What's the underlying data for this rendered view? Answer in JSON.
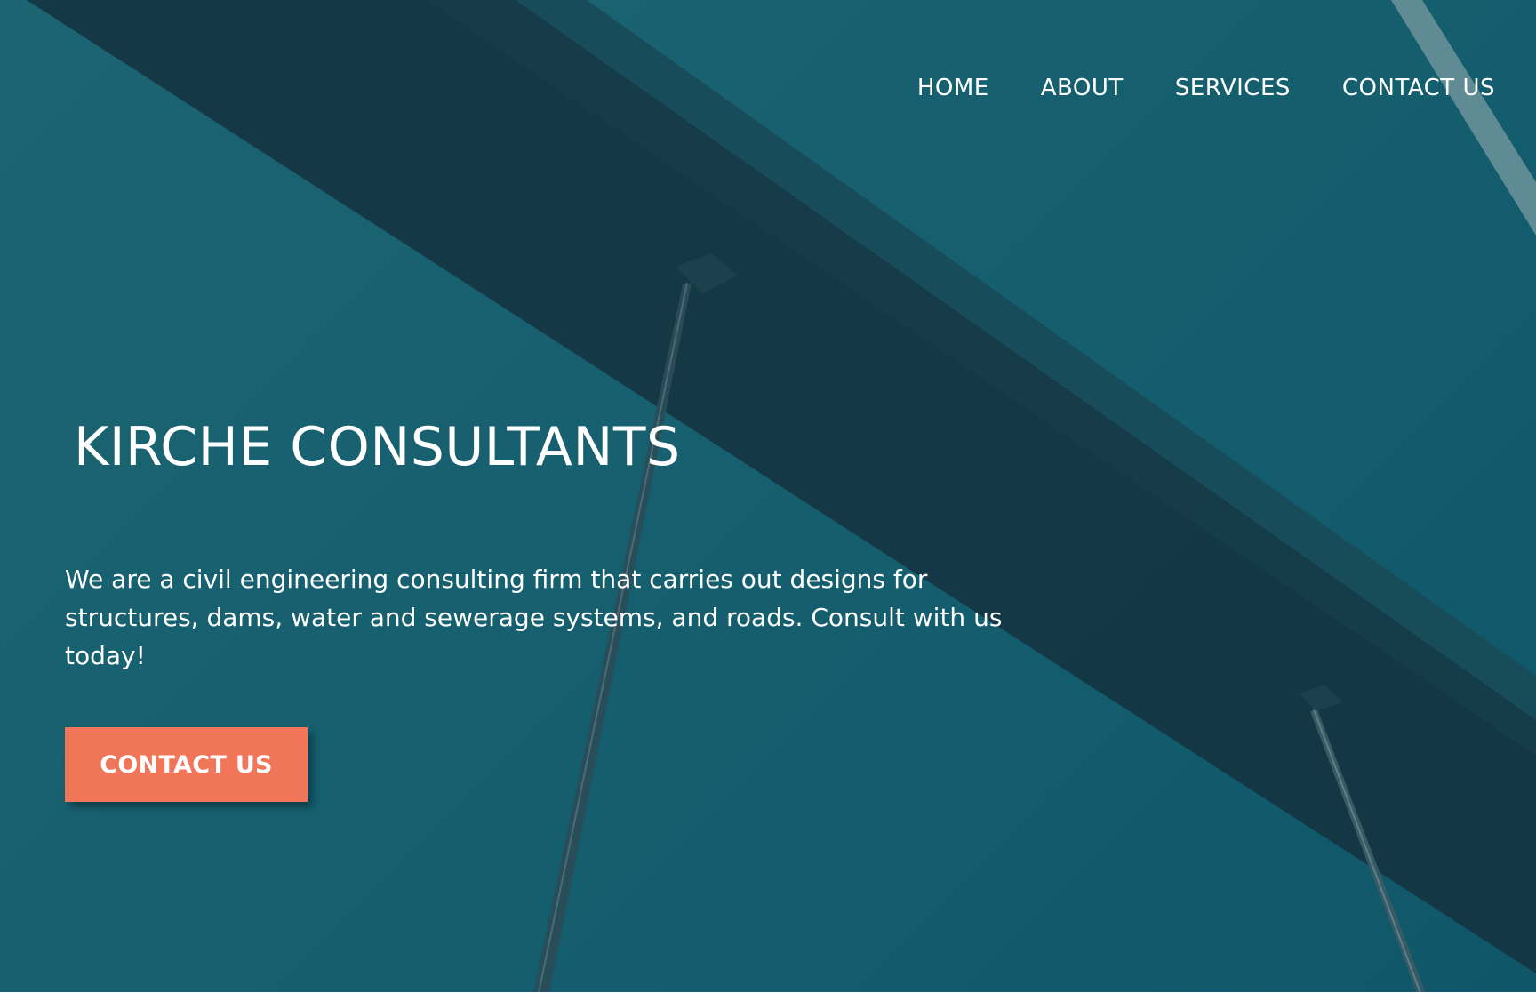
{
  "nav": {
    "items": [
      {
        "label": "HOME"
      },
      {
        "label": "ABOUT"
      },
      {
        "label": "SERVICES"
      },
      {
        "label": "CONTACT US"
      }
    ]
  },
  "hero": {
    "title": "KIRCHE CONSULTANTS",
    "tagline": "We are a civil engineering consulting firm that carries out designs for structures, dams, water and sewerage systems, and roads. Consult with us today!",
    "cta_label": "CONTACT US"
  },
  "colors": {
    "background": "#17606f",
    "beam": "#143643",
    "cta": "#f07559",
    "text": "#ffffff"
  },
  "background_image": "bridge-beam-photo"
}
